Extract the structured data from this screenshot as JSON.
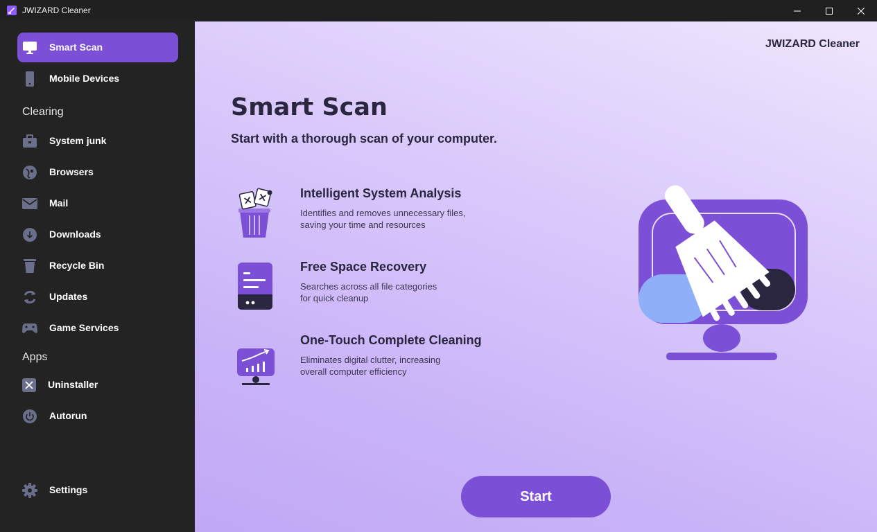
{
  "window": {
    "title": "JWIZARD Cleaner",
    "controls": [
      "minimize-icon",
      "maximize-icon",
      "close-icon"
    ]
  },
  "sidebar": {
    "items_top": [
      {
        "label": "Smart Scan",
        "icon": "monitor-icon",
        "active": true
      },
      {
        "label": "Mobile Devices",
        "icon": "phone-icon",
        "active": false
      }
    ],
    "section_clearing": "Clearing",
    "items_clearing": [
      {
        "label": "System junk",
        "icon": "briefcase-icon"
      },
      {
        "label": "Browsers",
        "icon": "globe-icon"
      },
      {
        "label": "Mail",
        "icon": "mail-icon"
      },
      {
        "label": "Downloads",
        "icon": "download-icon"
      },
      {
        "label": "Recycle Bin",
        "icon": "trash-icon"
      },
      {
        "label": "Updates",
        "icon": "refresh-icon"
      },
      {
        "label": "Game Services",
        "icon": "gamepad-icon"
      }
    ],
    "section_apps": "Apps",
    "items_apps": [
      {
        "label": "Uninstaller",
        "icon": "close-box-icon"
      },
      {
        "label": "Autorun",
        "icon": "power-icon"
      }
    ],
    "settings": {
      "label": "Settings",
      "icon": "gear-icon"
    }
  },
  "main": {
    "brand": "JWIZARD Cleaner",
    "title": "Smart Scan",
    "subtitle": "Start with a thorough scan of your computer.",
    "features": [
      {
        "title": "Intelligent System Analysis",
        "desc_line1": "Identifies and removes unnecessary files,",
        "desc_line2": "saving your time and resources",
        "icon": "trash-files-icon"
      },
      {
        "title": "Free Space Recovery",
        "desc_line1": "Searches across all file categories",
        "desc_line2": "for quick cleanup",
        "icon": "drive-icon"
      },
      {
        "title": "One-Touch Complete Cleaning",
        "desc_line1": "Eliminates digital clutter, increasing",
        "desc_line2": "overall computer efficiency",
        "icon": "chart-monitor-icon"
      }
    ],
    "illustration": "monitor-broom-illustration",
    "start_label": "Start"
  },
  "colors": {
    "accent": "#7b4fd6",
    "sidebar_bg": "#232323",
    "text_dark": "#2a2640"
  }
}
